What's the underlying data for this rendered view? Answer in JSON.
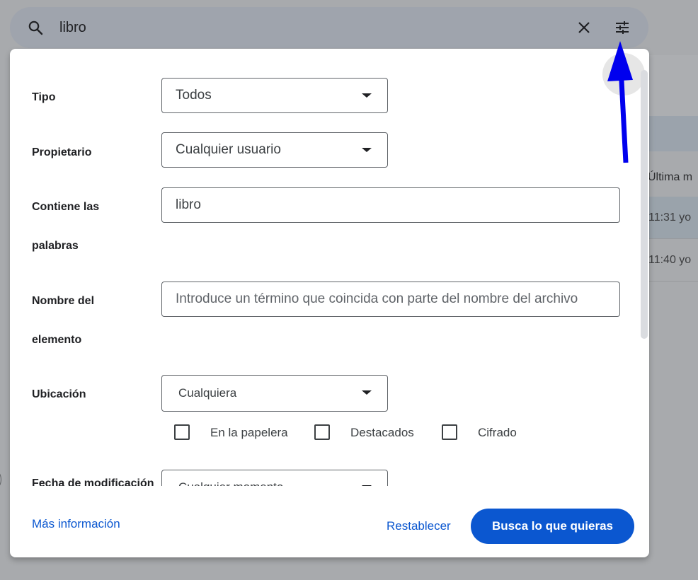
{
  "background": {
    "column_header": "Última m",
    "rows": [
      {
        "time": "11:31 yo"
      },
      {
        "time": "11:40 yo"
      }
    ]
  },
  "search_bar": {
    "query": "libro",
    "icons": {
      "search": "search-icon",
      "clear": "close-icon",
      "options": "tune-icon"
    }
  },
  "filters": {
    "type": {
      "label": "Tipo",
      "value": "Todos"
    },
    "owner": {
      "label": "Propietario",
      "value": "Cualquier usuario"
    },
    "contains_words": {
      "label": "Contiene las palabras",
      "value": "libro"
    },
    "item_name": {
      "label": "Nombre del elemento",
      "value": "",
      "placeholder": "Introduce un término que coincida con parte del nombre del archivo"
    },
    "location": {
      "label": "Ubicación",
      "value": "Cualquiera"
    },
    "checkboxes": [
      {
        "label": "En la papelera",
        "checked": false
      },
      {
        "label": "Destacados",
        "checked": false
      },
      {
        "label": "Cifrado",
        "checked": false
      }
    ],
    "date_modified": {
      "label": "Fecha de modificación",
      "value": "Cualquier momento"
    }
  },
  "footer": {
    "more_info": "Más información",
    "reset": "Restablecer",
    "search": "Busca lo que quieras"
  },
  "colors": {
    "accent": "#0b57d0",
    "annotation_arrow": "#0000ee"
  }
}
